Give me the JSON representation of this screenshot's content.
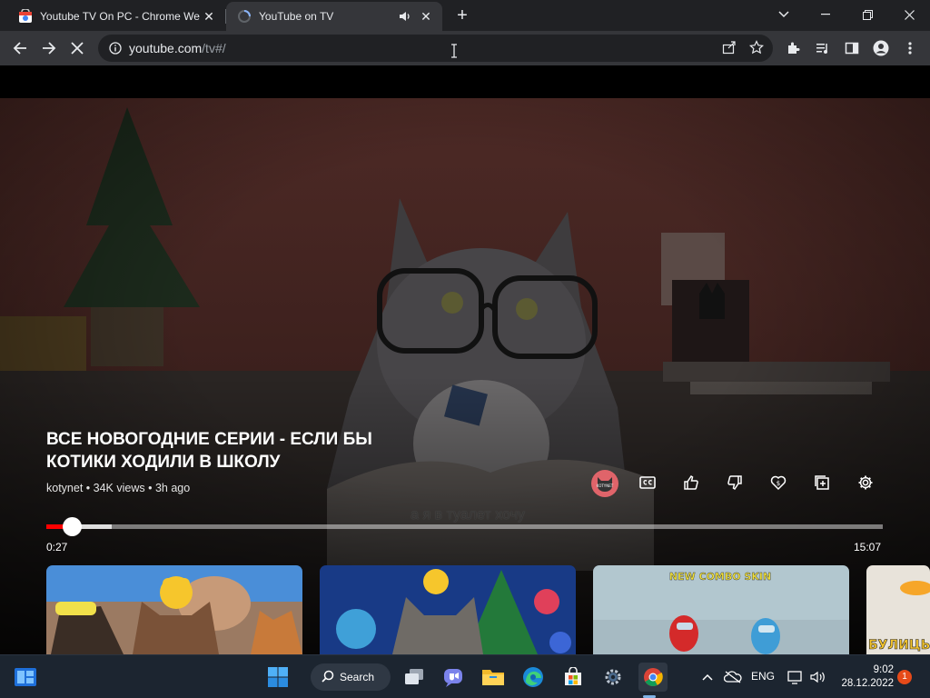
{
  "browser": {
    "tabs": [
      {
        "title": "Youtube TV On PC - Chrome Web Store",
        "close_label": "✕"
      },
      {
        "title": "YouTube on TV",
        "close_label": "✕"
      }
    ],
    "new_tab_label": "+",
    "address": {
      "domain": "youtube.com",
      "path": "/tv#/"
    }
  },
  "video": {
    "title": "ВСЕ НОВОГОДНИЕ СЕРИИ - ЕСЛИ БЫ КОТИКИ ХОДИЛИ В ШКОЛУ",
    "channel": "kotynet",
    "views": "34K views",
    "age": "3h ago",
    "meta_separator": " • ",
    "subtitle": "а я в туалет хочу",
    "time_current": "0:27",
    "time_total": "15:07",
    "progress_fraction": 0.03,
    "avatar_text": "KOTYNET"
  },
  "thumbnails": [
    {
      "alt": "cats with yellow hats and duck"
    },
    {
      "alt": "cat with duck and christmas tree"
    },
    {
      "alt": "NEW COMBO SKIN",
      "text": "NEW COMBO SKIN"
    },
    {
      "alt": "БУЛИЦЫ",
      "text": "БУЛИЦЫ"
    }
  ],
  "taskbar": {
    "search_label": "Search",
    "language": "ENG",
    "time": "9:02",
    "date": "28.12.2022",
    "notification_count": "1"
  },
  "colors": {
    "progress": "#ff0000",
    "avatar": "#e0646a",
    "taskbar": "#1c2530"
  }
}
